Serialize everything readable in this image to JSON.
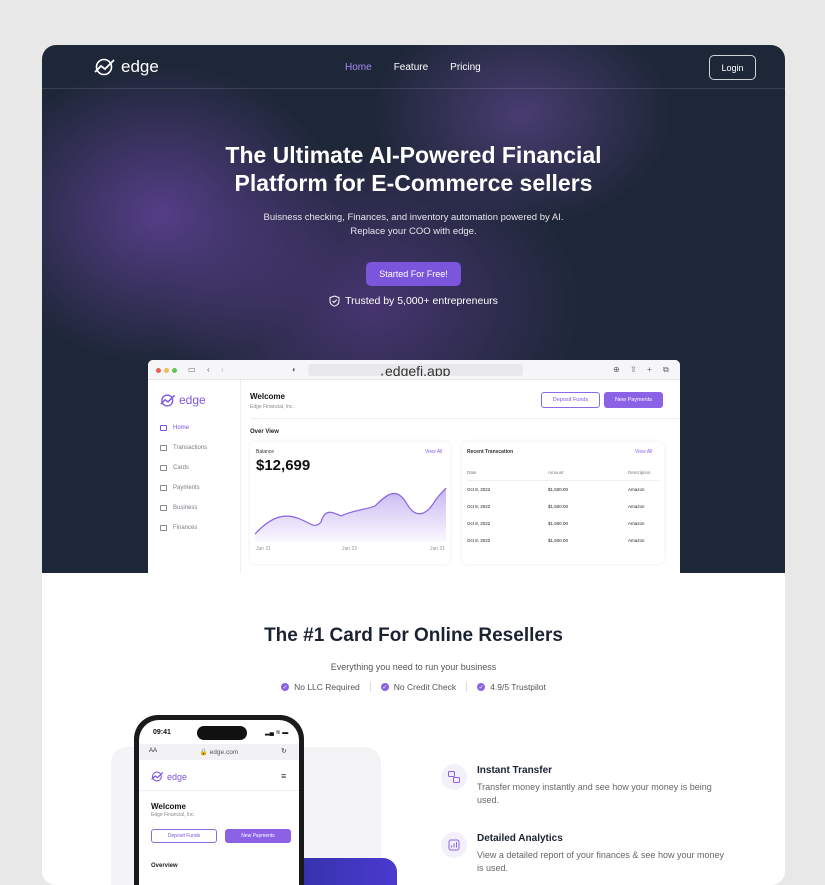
{
  "brand": {
    "name": "edge",
    "accent": "#7b55dc",
    "hero_bg": "#1e2738"
  },
  "nav": {
    "links": [
      {
        "label": "Home",
        "active": true
      },
      {
        "label": "Feature",
        "active": false
      },
      {
        "label": "Pricing",
        "active": false
      }
    ],
    "login": "Login"
  },
  "hero": {
    "title_line1": "The Ultimate AI-Powered Financial",
    "title_line2": "Platform for E-Commerce sellers",
    "sub_line1": "Buisness checking, Finances, and inventory automation powered by AI.",
    "sub_line2": "Replace your COO with edge.",
    "cta": "Started For Free!",
    "trust": "Trusted by 5,000+ entrepreneurs",
    "trust_icon": "shield-check-icon"
  },
  "browser": {
    "url": "edgefi.app",
    "dashboard": {
      "logo": "edge",
      "sidebar": [
        "Home",
        "Transactions",
        "Cards",
        "Payments",
        "Business",
        "Finances"
      ],
      "welcome": "Welcome",
      "company": "Edge Financial, Inc.",
      "deposit": "Deposit Funds",
      "new_payments": "New Payments",
      "overview": "Over View",
      "balance_label": "Balance",
      "view_all": "View All",
      "balance": "$12,699",
      "x_ticks": [
        "Jan 21",
        "Jan 22",
        "Jan 21"
      ],
      "recent_title": "Recent Transcation",
      "recent_view_all": "View All",
      "columns": [
        "Date",
        "Amount",
        "Description"
      ],
      "rows": [
        [
          "Oct 8, 2022",
          "$1,500.00",
          "Amazon"
        ],
        [
          "Oct 8, 2022",
          "$1,500.00",
          "Amazon"
        ],
        [
          "Oct 8, 2022",
          "$1,500.00",
          "Amazon"
        ],
        [
          "Oct 8, 2022",
          "$1,500.00",
          "Amazon"
        ]
      ]
    }
  },
  "section2": {
    "title": "The #1 Card For Online Resellers",
    "subtitle": "Everything you need to run your business",
    "checks": [
      "No LLC Required",
      "No Credit Check",
      "4.9/5 Trustpilot"
    ]
  },
  "phone": {
    "time": "09:41",
    "aa": "AA",
    "url": "edge.com",
    "logo": "edge",
    "welcome": "Welcome",
    "company": "Edge Financial, Inc.",
    "deposit": "Deposit Funds",
    "new_payments": "New Payments",
    "overview": "Overview"
  },
  "features": [
    {
      "title": "Instant Transfer",
      "desc": "Transfer money instantly and see how your money is being used.",
      "icon": "transfer-icon"
    },
    {
      "title": "Detailed Analytics",
      "desc": "View a detailed report of your finances & see how your money is used.",
      "icon": "analytics-icon"
    }
  ]
}
